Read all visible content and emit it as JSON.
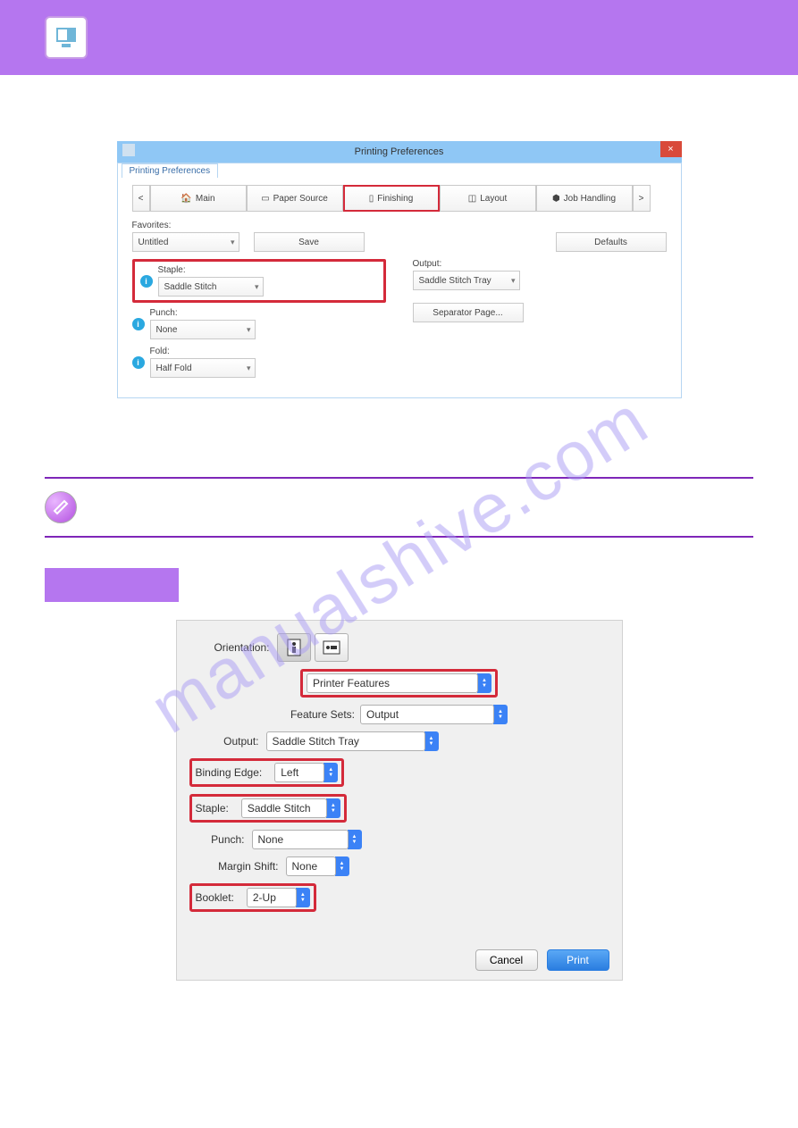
{
  "watermark": "manualshive.com",
  "windows": {
    "title": "Printing Preferences",
    "tab_label": "Printing Preferences",
    "nav": {
      "prev": "<",
      "next": ">",
      "main": "Main",
      "paper": "Paper Source",
      "finishing": "Finishing",
      "layout": "Layout",
      "job": "Job Handling"
    },
    "favorites_label": "Favorites:",
    "favorites_value": "Untitled",
    "save_btn": "Save",
    "defaults_btn": "Defaults",
    "staple_label": "Staple:",
    "staple_value": "Saddle Stitch",
    "punch_label": "Punch:",
    "punch_value": "None",
    "fold_label": "Fold:",
    "fold_value": "Half Fold",
    "output_label": "Output:",
    "output_value": "Saddle Stitch Tray",
    "separator_btn": "Separator Page..."
  },
  "mac": {
    "orientation_label": "Orientation:",
    "features_value": "Printer Features",
    "sets_label": "Feature Sets:",
    "sets_value": "Output",
    "output_label": "Output:",
    "output_value": "Saddle Stitch Tray",
    "binding_label": "Binding Edge:",
    "binding_value": "Left",
    "staple_label": "Staple:",
    "staple_value": "Saddle Stitch",
    "punch_label": "Punch:",
    "punch_value": "None",
    "margin_label": "Margin Shift:",
    "margin_value": "None",
    "booklet_label": "Booklet:",
    "booklet_value": "2-Up",
    "cancel": "Cancel",
    "print": "Print"
  }
}
